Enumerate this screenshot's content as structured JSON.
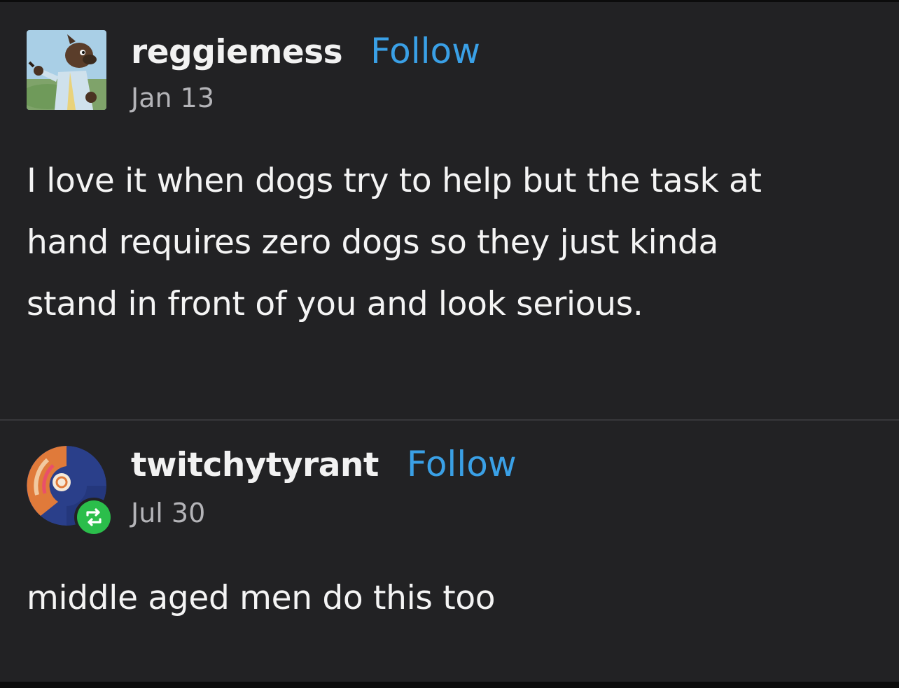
{
  "posts": [
    {
      "username": "reggiemess",
      "follow_label": "Follow",
      "date": "Jan 13",
      "avatar_icon": "furry-character-avatar",
      "body_lines": [
        "I love it when dogs try to help but the task at",
        "hand requires zero dogs so they just kinda",
        "stand in front of you and look serious."
      ]
    },
    {
      "username": "twitchytyrant",
      "follow_label": "Follow",
      "date": "Jul 30",
      "avatar_icon": "orange-blue-circle-avatar",
      "badge_icon": "reblog-icon",
      "body_lines": [
        "middle aged men do this too"
      ]
    }
  ],
  "colors": {
    "background": "#222224",
    "follow_link": "#3aa0e6",
    "reblog_badge": "#2bbe4b"
  }
}
